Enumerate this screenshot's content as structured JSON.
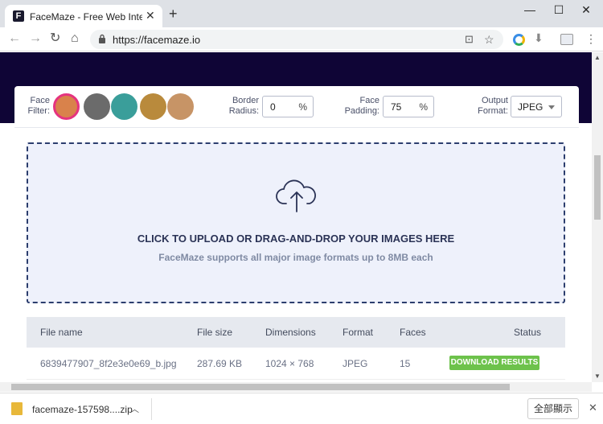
{
  "browser": {
    "tab_title": "FaceMaze - Free Web Interface",
    "favicon_letter": "F",
    "tab_close": "✕",
    "new_tab": "+",
    "window_controls": [
      "—",
      "☐",
      "✕"
    ],
    "url": "https://facemaze.io",
    "nav": {
      "back": "←",
      "forward": "→",
      "reload": "↻",
      "home": "⌂"
    },
    "toolbar_icons": [
      "translate-icon",
      "star-icon",
      "extension-icon",
      "download-icon",
      "profile-icon",
      "menu-icon"
    ]
  },
  "settings": {
    "face_filter_label": [
      "Face",
      "Filter:"
    ],
    "filters": [
      {
        "name": "original",
        "color": "#d9824b",
        "selected": true
      },
      {
        "name": "grayscale",
        "color": "#6b6b6b",
        "selected": false
      },
      {
        "name": "teal",
        "color": "#3a9e9a",
        "selected": false
      },
      {
        "name": "sepia",
        "color": "#b98a3c",
        "selected": false
      },
      {
        "name": "warm",
        "color": "#c79466",
        "selected": false
      }
    ],
    "border_radius_label": [
      "Border",
      "Radius:"
    ],
    "border_radius_value": "0",
    "face_padding_label": [
      "Face",
      "Padding:"
    ],
    "face_padding_value": "75",
    "percent_unit": "%",
    "output_format_label": [
      "Output",
      "Format:"
    ],
    "output_format_value": "JPEG"
  },
  "upload": {
    "title": "CLICK TO UPLOAD OR DRAG-AND-DROP YOUR IMAGES HERE",
    "subtitle": "FaceMaze supports all major image formats up to 8MB each"
  },
  "table": {
    "headers": {
      "file_name": "File name",
      "file_size": "File size",
      "dimensions": "Dimensions",
      "format": "Format",
      "faces": "Faces",
      "status": "Status"
    },
    "rows": [
      {
        "file_name": "6839477907_8f2e3e0e69_b.jpg",
        "file_size": "287.69 KB",
        "dimensions": "1024 × 768",
        "format": "JPEG",
        "faces": "15",
        "status": "DOWNLOAD RESULTS"
      }
    ]
  },
  "download_bar": {
    "file_name": "facemaze-157598....zip",
    "show_all": "全部顯示",
    "close": "✕"
  }
}
